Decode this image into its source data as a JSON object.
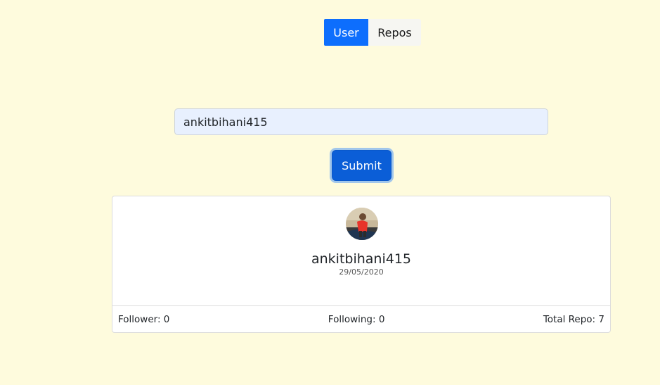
{
  "tabs": {
    "user_label": "User",
    "repos_label": "Repos"
  },
  "search": {
    "value": "ankitbihani415",
    "placeholder": ""
  },
  "submit": {
    "label": "Submit"
  },
  "profile": {
    "avatar_icon": "user-avatar-photo",
    "username": "ankitbihani415",
    "joined": "29/05/2020",
    "followers_label": "Follower: 0",
    "following_label": "Following: 0",
    "repos_label": "Total Repo: 7"
  },
  "colors": {
    "background": "#fefbdd",
    "accent": "#0d6efd",
    "submit": "#0b5ed7",
    "input_bg": "#e8f0fe"
  }
}
